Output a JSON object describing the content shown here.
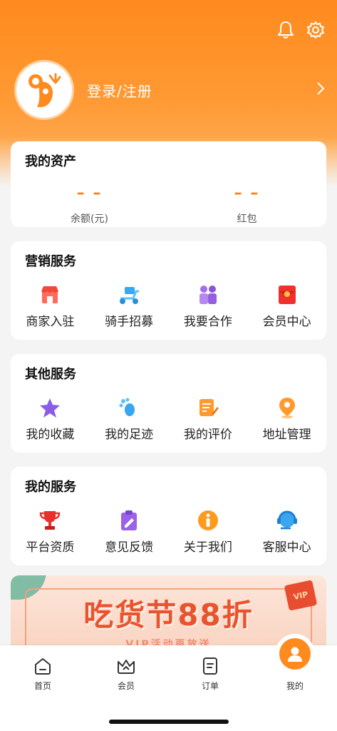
{
  "header": {
    "login_label": "登录/注册",
    "icons": [
      "bell-icon",
      "gear-icon",
      "chevron-right-icon",
      "koala-avatar-icon"
    ]
  },
  "assets": {
    "title": "我的资产",
    "items": [
      {
        "value": "– –",
        "label": "余额(元)"
      },
      {
        "value": "– –",
        "label": "红包"
      }
    ]
  },
  "marketing": {
    "title": "营销服务",
    "items": [
      {
        "label": "商家入驻",
        "icon": "store-icon"
      },
      {
        "label": "骑手招募",
        "icon": "scooter-icon"
      },
      {
        "label": "我要合作",
        "icon": "partners-icon"
      },
      {
        "label": "会员中心",
        "icon": "red-envelope-icon"
      }
    ]
  },
  "other": {
    "title": "其他服务",
    "items": [
      {
        "label": "我的收藏",
        "icon": "star-icon"
      },
      {
        "label": "我的足迹",
        "icon": "footprint-icon"
      },
      {
        "label": "我的评价",
        "icon": "review-icon"
      },
      {
        "label": "地址管理",
        "icon": "location-pin-icon"
      }
    ]
  },
  "mine": {
    "title": "我的服务",
    "items": [
      {
        "label": "平台资质",
        "icon": "trophy-icon"
      },
      {
        "label": "意见反馈",
        "icon": "feedback-clipboard-icon"
      },
      {
        "label": "关于我们",
        "icon": "info-icon"
      },
      {
        "label": "客服中心",
        "icon": "headset-icon"
      }
    ]
  },
  "banner": {
    "title": "吃货节88折",
    "subtitle": "VIP活动再放送",
    "tag": "VIP"
  },
  "tabbar": {
    "tabs": [
      {
        "label": "首页",
        "icon": "home-icon"
      },
      {
        "label": "会员",
        "icon": "crown-icon"
      },
      {
        "label": "订单",
        "icon": "order-icon"
      },
      {
        "label": "我的",
        "icon": "user-icon"
      }
    ]
  },
  "colors": {
    "brand_orange": "#ff8a1e",
    "dash_orange": "#ff7d14",
    "banner_red": "#e8542e"
  }
}
